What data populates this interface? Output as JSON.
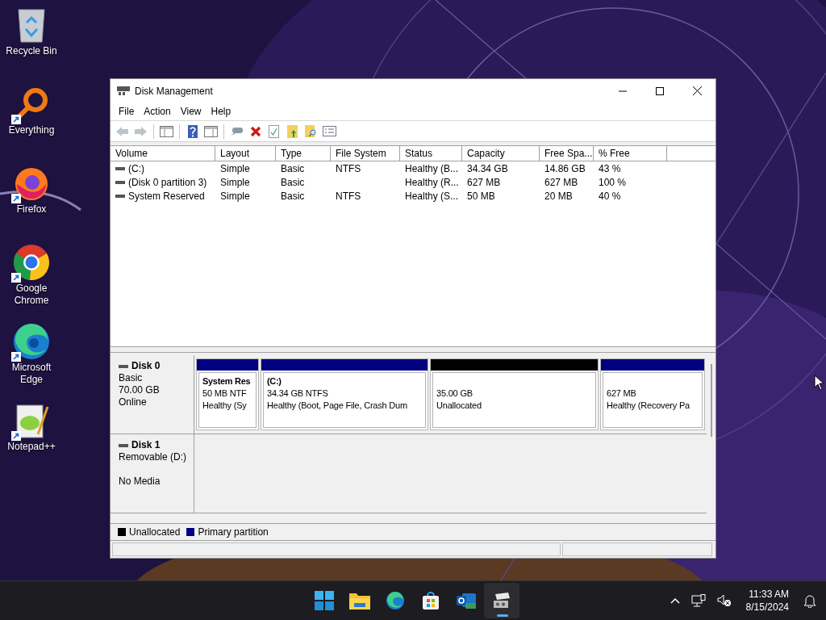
{
  "desktop": {
    "icons": [
      {
        "kind": "bin",
        "label": "Recycle Bin",
        "shortcut": false
      },
      {
        "kind": "ring",
        "label": "Everything",
        "shortcut": true
      },
      {
        "kind": "fox",
        "label": "Firefox",
        "shortcut": true
      },
      {
        "kind": "globe",
        "label": "Google Chrome",
        "shortcut": true
      },
      {
        "kind": "wave",
        "label": "Microsoft Edge",
        "shortcut": true
      },
      {
        "kind": "notepad",
        "label": "Notepad++",
        "shortcut": true
      }
    ]
  },
  "window": {
    "title": "Disk Management",
    "menu": [
      "File",
      "Action",
      "View",
      "Help"
    ],
    "toolbar": [
      {
        "kind": "back",
        "disabled": true
      },
      {
        "kind": "forward",
        "disabled": true
      },
      {
        "kind": "sep"
      },
      {
        "kind": "panel",
        "disabled": false
      },
      {
        "kind": "sep"
      },
      {
        "kind": "help",
        "disabled": false
      },
      {
        "kind": "panel2",
        "disabled": false
      },
      {
        "kind": "sep"
      },
      {
        "kind": "connect",
        "disabled": false
      },
      {
        "kind": "delete",
        "disabled": false
      },
      {
        "kind": "check",
        "disabled": false
      },
      {
        "kind": "folderup",
        "disabled": false
      },
      {
        "kind": "foldersearch",
        "disabled": false
      },
      {
        "kind": "props",
        "disabled": false
      }
    ],
    "volumes": {
      "columns": [
        "Volume",
        "Layout",
        "Type",
        "File System",
        "Status",
        "Capacity",
        "Free Spa...",
        "% Free"
      ],
      "rows": [
        [
          "(C:)",
          "Simple",
          "Basic",
          "NTFS",
          "Healthy (B...",
          "34.34 GB",
          "14.86 GB",
          "43 %"
        ],
        [
          "(Disk 0 partition 3)",
          "Simple",
          "Basic",
          "",
          "Healthy (R...",
          "627 MB",
          "627 MB",
          "100 %"
        ],
        [
          "System Reserved",
          "Simple",
          "Basic",
          "NTFS",
          "Healthy (S...",
          "50 MB",
          "20 MB",
          "40 %"
        ]
      ]
    },
    "disks": [
      {
        "name": "Disk 0",
        "type": "Basic",
        "size": "70.00 GB",
        "status": "Online",
        "partitions": [
          {
            "color": "#000080",
            "name": "System Res",
            "size": "50 MB NTF",
            "status": "Healthy (Sy"
          },
          {
            "color": "#000080",
            "name": "(C:)",
            "size": "34.34 GB NTFS",
            "status": "Healthy (Boot, Page File, Crash Dum"
          },
          {
            "color": "#000000",
            "size": "35.00 GB",
            "status": "Unallocated"
          },
          {
            "color": "#000080",
            "size": "627 MB",
            "status": "Healthy (Recovery Pa"
          }
        ]
      },
      {
        "name": "Disk 1",
        "type": "Removable (D:)",
        "status": "No Media"
      }
    ],
    "legend": [
      {
        "label": "Unallocated",
        "color": "#000000"
      },
      {
        "label": "Primary partition",
        "color": "#000080"
      }
    ]
  },
  "taskbar": {
    "apps": [
      {
        "kind": "start",
        "active": false
      },
      {
        "kind": "folder",
        "active": false
      },
      {
        "kind": "wave",
        "active": false
      },
      {
        "kind": "store",
        "active": false
      },
      {
        "kind": "mail",
        "active": false
      },
      {
        "kind": "disk",
        "active": true
      }
    ],
    "time": "11:33 AM",
    "date": "8/15/2024"
  }
}
